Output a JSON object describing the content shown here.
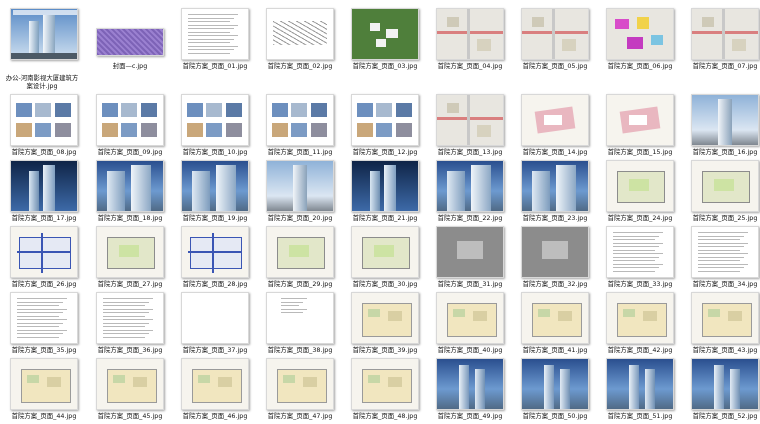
{
  "files": [
    {
      "name": "办公-河南影视大厦建筑方案设计.jpg",
      "thumb": "cover"
    },
    {
      "name": "封面—c.jpg",
      "thumb": "purple"
    },
    {
      "name": "首院方案_页面_01.jpg",
      "thumb": "text"
    },
    {
      "name": "首院方案_页面_02.jpg",
      "thumb": "sketch"
    },
    {
      "name": "首院方案_页面_03.jpg",
      "thumb": "green"
    },
    {
      "name": "首院方案_页面_04.jpg",
      "thumb": "map"
    },
    {
      "name": "首院方案_页面_05.jpg",
      "thumb": "map"
    },
    {
      "name": "首院方案_页面_06.jpg",
      "thumb": "map-color"
    },
    {
      "name": "首院方案_页面_07.jpg",
      "thumb": "map"
    },
    {
      "name": "首院方案_页面_08.jpg",
      "thumb": "collage"
    },
    {
      "name": "首院方案_页面_09.jpg",
      "thumb": "collage"
    },
    {
      "name": "首院方案_页面_10.jpg",
      "thumb": "collage"
    },
    {
      "name": "首院方案_页面_11.jpg",
      "thumb": "collage"
    },
    {
      "name": "首院方案_页面_12.jpg",
      "thumb": "collage"
    },
    {
      "name": "首院方案_页面_13.jpg",
      "thumb": "map"
    },
    {
      "name": "首院方案_页面_14.jpg",
      "thumb": "site"
    },
    {
      "name": "首院方案_页面_15.jpg",
      "thumb": "site"
    },
    {
      "name": "首院方案_页面_16.jpg",
      "thumb": "tower"
    },
    {
      "name": "首院方案_页面_17.jpg",
      "thumb": "dark"
    },
    {
      "name": "首院方案_页面_18.jpg",
      "thumb": "sky"
    },
    {
      "name": "首院方案_页面_19.jpg",
      "thumb": "sky"
    },
    {
      "name": "首院方案_页面_20.jpg",
      "thumb": "tower"
    },
    {
      "name": "首院方案_页面_21.jpg",
      "thumb": "dark"
    },
    {
      "name": "首院方案_页面_22.jpg",
      "thumb": "sky"
    },
    {
      "name": "首院方案_页面_23.jpg",
      "thumb": "sky"
    },
    {
      "name": "首院方案_页面_24.jpg",
      "thumb": "plan"
    },
    {
      "name": "首院方案_页面_25.jpg",
      "thumb": "plan"
    },
    {
      "name": "首院方案_页面_26.jpg",
      "thumb": "plan-blue"
    },
    {
      "name": "首院方案_页面_27.jpg",
      "thumb": "plan"
    },
    {
      "name": "首院方案_页面_28.jpg",
      "thumb": "plan-blue"
    },
    {
      "name": "首院方案_页面_29.jpg",
      "thumb": "plan"
    },
    {
      "name": "首院方案_页面_30.jpg",
      "thumb": "plan"
    },
    {
      "name": "首院方案_页面_31.jpg",
      "thumb": "gray"
    },
    {
      "name": "首院方案_页面_32.jpg",
      "thumb": "gray"
    },
    {
      "name": "首院方案_页面_33.jpg",
      "thumb": "text"
    },
    {
      "name": "首院方案_页面_34.jpg",
      "thumb": "text"
    },
    {
      "name": "首院方案_页面_35.jpg",
      "thumb": "text"
    },
    {
      "name": "首院方案_页面_36.jpg",
      "thumb": "text"
    },
    {
      "name": "首院方案_页面_37.jpg",
      "thumb": "blank"
    },
    {
      "name": "首院方案_页面_38.jpg",
      "thumb": "text-small"
    },
    {
      "name": "首院方案_页面_39.jpg",
      "thumb": "floor"
    },
    {
      "name": "首院方案_页面_40.jpg",
      "thumb": "floor"
    },
    {
      "name": "首院方案_页面_41.jpg",
      "thumb": "floor"
    },
    {
      "name": "首院方案_页面_42.jpg",
      "thumb": "floor"
    },
    {
      "name": "首院方案_页面_43.jpg",
      "thumb": "floor"
    },
    {
      "name": "首院方案_页面_44.jpg",
      "thumb": "floor"
    },
    {
      "name": "首院方案_页面_45.jpg",
      "thumb": "floor"
    },
    {
      "name": "首院方案_页面_46.jpg",
      "thumb": "floor"
    },
    {
      "name": "首院方案_页面_47.jpg",
      "thumb": "floor"
    },
    {
      "name": "首院方案_页面_48.jpg",
      "thumb": "floor"
    },
    {
      "name": "首院方案_页面_49.jpg",
      "thumb": "twin"
    },
    {
      "name": "首院方案_页面_50.jpg",
      "thumb": "twin"
    },
    {
      "name": "首院方案_页面_51.jpg",
      "thumb": "twin"
    },
    {
      "name": "首院方案_页面_52.jpg",
      "thumb": "twin"
    }
  ],
  "cover_title": "办公-河南影视大厦建筑方案设计"
}
